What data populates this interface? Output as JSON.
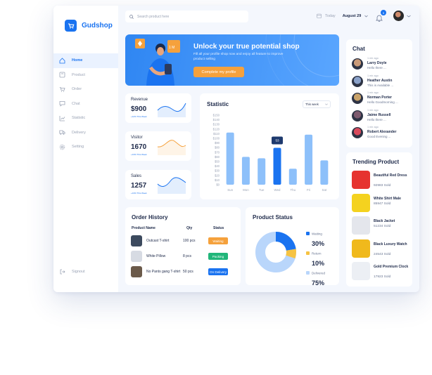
{
  "brand": {
    "name": "Gudshop"
  },
  "nav": [
    {
      "label": "Home",
      "icon": "home-icon",
      "active": true
    },
    {
      "label": "Product",
      "icon": "product-icon"
    },
    {
      "label": "Order",
      "icon": "cart-icon"
    },
    {
      "label": "Chat",
      "icon": "chat-icon"
    },
    {
      "label": "Statistic",
      "icon": "chart-icon"
    },
    {
      "label": "Delivery",
      "icon": "truck-icon"
    },
    {
      "label": "Setting",
      "icon": "gear-icon"
    }
  ],
  "signout": "Signout",
  "search": {
    "placeholder": "Search product here"
  },
  "date": {
    "label": "Today",
    "value": "August 29"
  },
  "notifications": {
    "count": "5"
  },
  "banner": {
    "title": "Unlock your true potential shop",
    "text": "Fill all your profile shop now and enjoy all feature to improve product selling",
    "button": "Complete my profile"
  },
  "stats": [
    {
      "title": "Revenue",
      "value": "$900",
      "sub": "+12% This Week"
    },
    {
      "title": "Visitor",
      "value": "1670",
      "sub": "+13% This Week"
    },
    {
      "title": "Sales",
      "value": "1257",
      "sub": "+13% This Week"
    }
  ],
  "statistic": {
    "title": "Statistic",
    "filter": "This week"
  },
  "chart_data": {
    "type": "bar",
    "categories": [
      "Sun",
      "Mon",
      "Tue",
      "Wed",
      "Thu",
      "Fri",
      "Sat"
    ],
    "values": [
      75,
      40,
      38,
      53,
      23,
      72,
      35
    ],
    "tooltip": "53",
    "y_ticks": [
      "$150",
      "$140",
      "$130",
      "$120",
      "$110",
      "$100",
      "$90",
      "$80",
      "$70",
      "$60",
      "$50",
      "$40",
      "$30",
      "$20",
      "$10",
      "$0"
    ],
    "highlight_index": 3
  },
  "order_history": {
    "title": "Order History",
    "headers": [
      "Product Name",
      "Qty",
      "Status"
    ],
    "rows": [
      {
        "name": "Outcast T-shirt",
        "qty": "100 pcs",
        "status": "Waiting",
        "color": "#f5a13c"
      },
      {
        "name": "White Pillow",
        "qty": "8 pcs",
        "status": "Packing",
        "color": "#22b67a"
      },
      {
        "name": "No Pants gang T-shirt",
        "qty": "50 pcs",
        "status": "On Delivery",
        "color": "#1a73f0"
      }
    ]
  },
  "product_status": {
    "title": "Product Status",
    "items": [
      {
        "label": "Waiting",
        "value": "30%",
        "color": "#1a73f0"
      },
      {
        "label": "Return",
        "value": "10%",
        "color": "#f6c343"
      },
      {
        "label": "Delivered",
        "value": "75%",
        "color": "#b9d6fb"
      }
    ]
  },
  "chat": {
    "title": "Chat",
    "items": [
      {
        "time": "1 mir ago",
        "name": "Larry Doyle",
        "msg": "Hello there ...",
        "color": "#c99a78"
      },
      {
        "time": "1 mir ago",
        "name": "Heather Austin",
        "msg": "This is Available ...",
        "color": "#8aa1c9"
      },
      {
        "time": "1 mir ago",
        "name": "Norman Porter",
        "msg": "Hello Goodmorning ...",
        "color": "#caa36a"
      },
      {
        "time": "1 mir ago",
        "name": "Jaime Russell",
        "msg": "Hello there ...",
        "color": "#7d5a6e"
      },
      {
        "time": "1 mir ago",
        "name": "Robert Alexander",
        "msg": "Good Evening ...",
        "color": "#d94a5c"
      }
    ]
  },
  "trending": {
    "title": "Trending Product",
    "items": [
      {
        "name": "Beautiful Red Dress",
        "sold": "92983 Sold",
        "color": "#e6332f"
      },
      {
        "name": "White Shirt Male",
        "sold": "85947 Sold",
        "color": "#f4d21f"
      },
      {
        "name": "Black Jacket",
        "sold": "51234 Sold",
        "color": "#e4e6ec"
      },
      {
        "name": "Black Luxury Watch",
        "sold": "24543 Sold",
        "color": "#f0b91c"
      },
      {
        "name": "Gold Premium Clock",
        "sold": "17923 Sold",
        "color": "#eceff4"
      }
    ]
  }
}
